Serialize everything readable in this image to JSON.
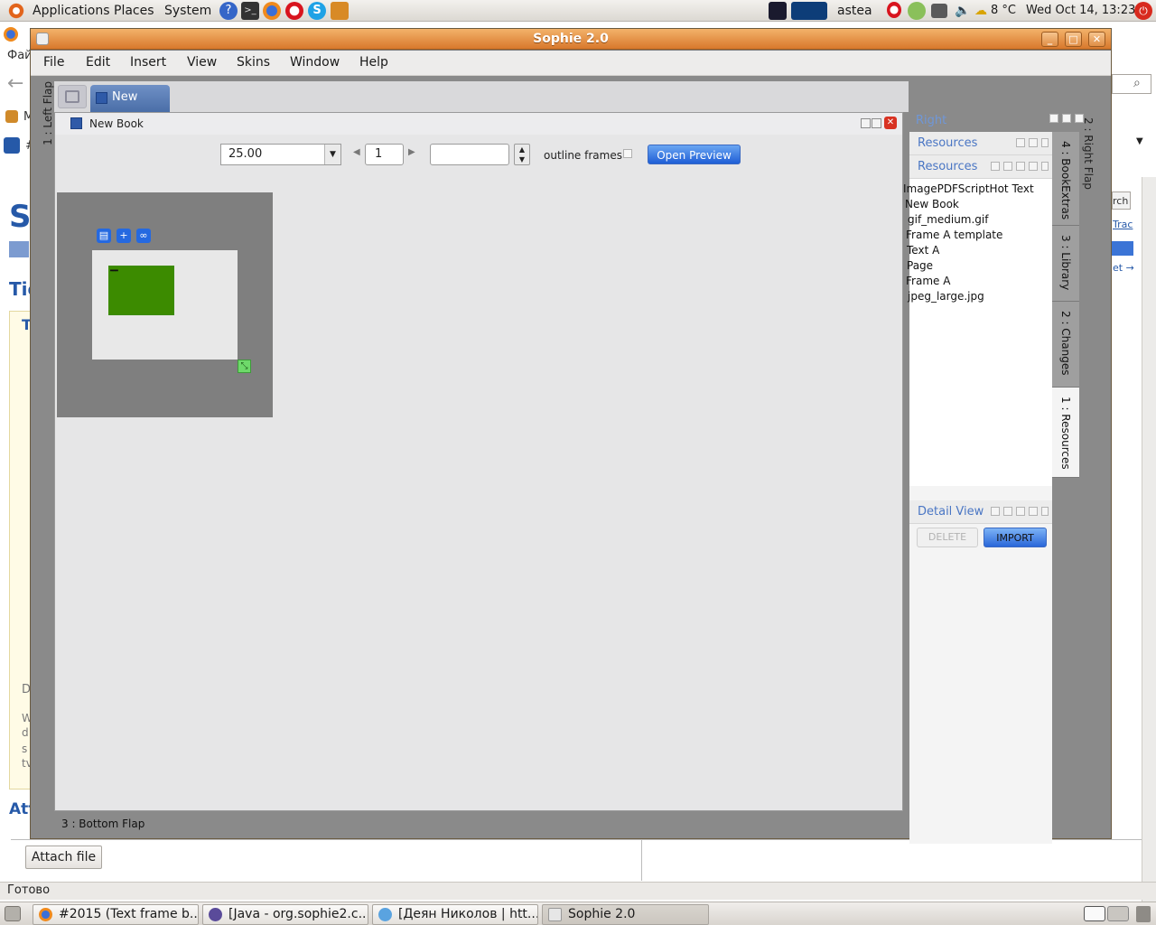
{
  "top_panel": {
    "menus": [
      "Applications",
      "Places",
      "System"
    ],
    "user": "astea",
    "weather": "8 °C",
    "clock": "Wed Oct 14, 13:23"
  },
  "background_window": {
    "menu_fragment": "Фай",
    "search_fragment": "rch",
    "link_fragment_1": "Trac",
    "link_fragment_2": "et →",
    "heading_fragment_1": "S",
    "heading_fragment_2": "Tic",
    "heading_fragment_3": "T",
    "heading_fragment_4": "Att",
    "text_fragment_d": "D",
    "text_fragment_w": "W",
    "text_fragment_d2": "d",
    "text_fragment_s": "s",
    "text_fragment_tv": "tv",
    "tab_fragment_m": "M",
    "tab_fragment_hash": "#",
    "attach_button": "Attach file",
    "status": "Готово"
  },
  "taskbar": {
    "items": [
      "#2015 (Text frame b...",
      "[Java - org.sophie2.c...",
      "[Деян Николов | htt...",
      "Sophie 2.0"
    ]
  },
  "sophie": {
    "title": "Sophie 2.0",
    "menu": [
      "File",
      "Edit",
      "Insert",
      "View",
      "Skins",
      "Window",
      "Help"
    ],
    "left_flap": "1 : Left Flap",
    "doc_tab": "New Book",
    "book_frame_title": "New Book",
    "toolbar": {
      "zoom": "25.00",
      "page": "1",
      "spin_value": "",
      "outline_label": "outline frames",
      "preview_button": "Open Preview"
    },
    "bottom_flap": "3 : Bottom Flap",
    "right_flap_label": "Right",
    "right_flap_side": "2 : Right Flap",
    "right_panel": {
      "header_1": "Resources",
      "header_2": "Resources",
      "items": [
        "ImagePDFScriptHot Text",
        "New Book",
        "gif_medium.gif",
        "Frame A template",
        "Text A",
        "Page",
        "Frame A",
        "jpeg_large.jpg"
      ],
      "detail_header": "Detail View",
      "delete_button": "DELETE",
      "import_button": "IMPORT"
    },
    "right_tabs": [
      "4 : BookExtras",
      "3 : Library",
      "2 : Changes",
      "1 : Resources"
    ]
  }
}
